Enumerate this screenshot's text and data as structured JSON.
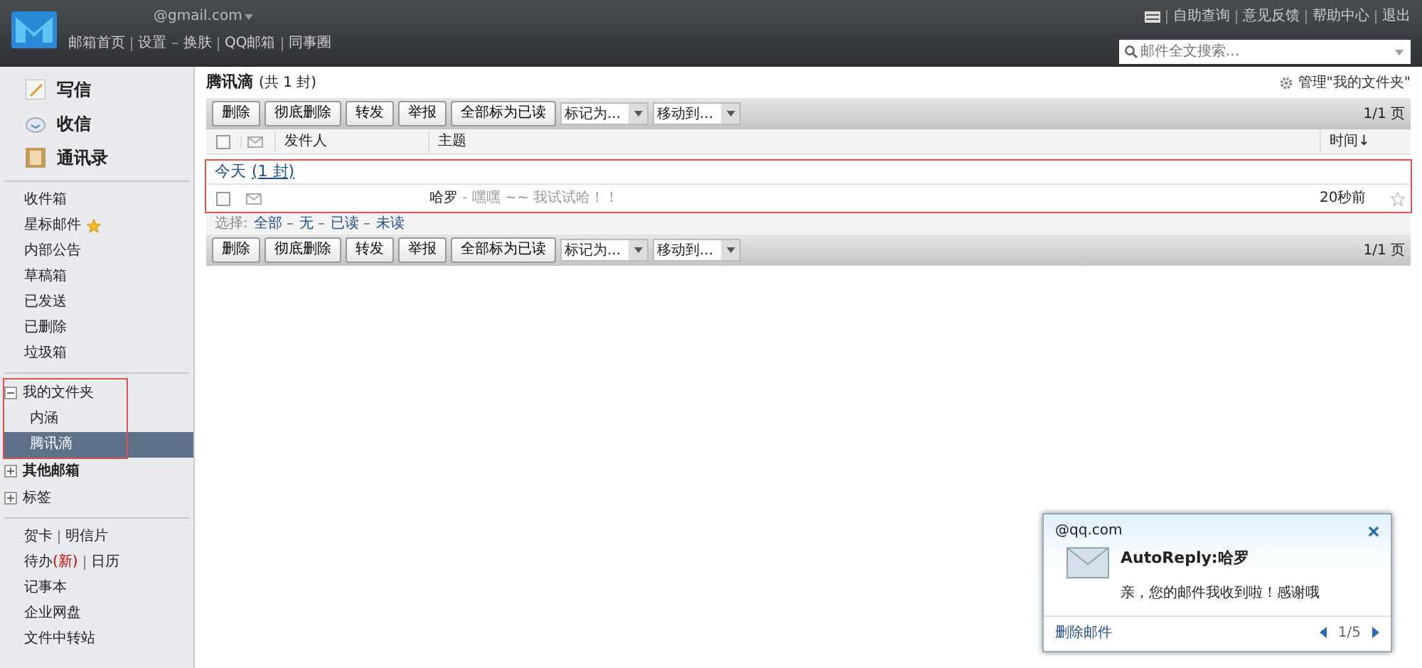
{
  "header": {
    "account": "@gmail.com",
    "links": [
      "邮箱首页",
      "设置",
      "换肤",
      "QQ邮箱",
      "同事圈"
    ],
    "top_links": [
      "自助查询",
      "意见反馈",
      "帮助中心",
      "退出"
    ],
    "search": {
      "placeholder": "邮件全文搜索..."
    }
  },
  "sidebar": {
    "actions": [
      "写信",
      "收信",
      "通讯录"
    ],
    "folders": [
      {
        "label": "收件箱",
        "starred": false
      },
      {
        "label": "星标邮件",
        "starred": true
      },
      {
        "label": "内部公告",
        "starred": false
      },
      {
        "label": "草稿箱",
        "starred": false
      },
      {
        "label": "已发送",
        "starred": false
      },
      {
        "label": "已删除",
        "starred": false
      },
      {
        "label": "垃圾箱",
        "starred": false
      }
    ],
    "groups": [
      {
        "label": "我的文件夹",
        "expanded": true,
        "bold": false,
        "children": [
          {
            "label": "内涵",
            "selected": false
          },
          {
            "label": "腾讯滴",
            "selected": true
          }
        ]
      },
      {
        "label": "其他邮箱",
        "expanded": false,
        "bold": true
      },
      {
        "label": "标签",
        "expanded": false,
        "bold": false
      }
    ],
    "tools": [
      [
        "贺卡",
        "明信片"
      ],
      [
        "待办",
        "日历"
      ],
      [
        "记事本"
      ],
      [
        "企业网盘"
      ],
      [
        "文件中转站"
      ]
    ],
    "new_badge": "(新)"
  },
  "folder": {
    "title": "腾讯滴",
    "count": "(共 1 封)",
    "manage": "管理\"我的文件夹\"",
    "toolbars": [
      {
        "buttons": [
          "删除",
          "彻底删除",
          "转发",
          "举报",
          "全部标为已读"
        ],
        "dropdowns": [
          "标记为...",
          "移动到..."
        ],
        "page": "1/1 页"
      },
      {
        "buttons": [
          "删除",
          "彻底删除",
          "转发",
          "举报",
          "全部标为已读"
        ],
        "dropdowns": [
          "标记为...",
          "移动到..."
        ],
        "page": "1/1 页"
      }
    ],
    "select_all_checked": false,
    "columns": [
      "发件人",
      "主题",
      "时间↓"
    ],
    "group": {
      "label": "今天",
      "count": "(1 封)"
    },
    "rows": [
      {
        "subject": "哈罗",
        "preview": " - 嘿嘿 ~~ 我试试哈！！",
        "time": "20秒前",
        "checked": false,
        "starred": false
      }
    ],
    "select": {
      "label": "选择:",
      "options": [
        "全部",
        "无",
        "已读",
        "未读"
      ]
    }
  },
  "popup": {
    "sender": "@qq.com",
    "subject": "AutoReply:哈罗",
    "body": "亲，您的邮件我收到啦！感谢哦",
    "delete": "删除邮件",
    "pager": "1/5"
  }
}
